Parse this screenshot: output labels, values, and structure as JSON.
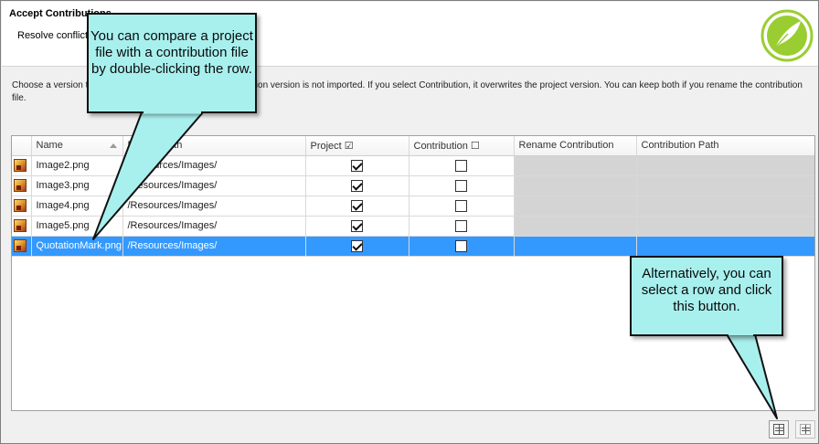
{
  "header": {
    "title": "Accept Contributions",
    "subtitle": "Resolve conflicts"
  },
  "instructions": "Choose a version to keep. If you select Project, the contribution version is not imported. If you select Contribution, it overwrites the project version. You can keep both if you rename the contribution file.",
  "table": {
    "columns": [
      "Name",
      "Project Path",
      "Project ☑",
      "Contribution ☐",
      "Rename Contribution",
      "Contribution Path"
    ],
    "rows": [
      {
        "name": "Image2.png",
        "path": "/Resources/Images/",
        "project": true,
        "contribution": false,
        "selected": false
      },
      {
        "name": "Image3.png",
        "path": "/Resources/Images/",
        "project": true,
        "contribution": false,
        "selected": false
      },
      {
        "name": "Image4.png",
        "path": "/Resources/Images/",
        "project": true,
        "contribution": false,
        "selected": false
      },
      {
        "name": "Image5.png",
        "path": "/Resources/Images/",
        "project": true,
        "contribution": false,
        "selected": false
      },
      {
        "name": "QuotationMark.png",
        "path": "/Resources/Images/",
        "project": true,
        "contribution": false,
        "selected": true
      }
    ]
  },
  "callouts": {
    "compare_row": "You can compare a project file with a contribution file by double-clicking the row.",
    "compare_button": "Alternatively, you can select a row and click this button."
  },
  "colors": {
    "callout_fill": "#a8f0ee",
    "selection": "#3399ff",
    "logo_green": "#9acd32"
  },
  "icons": {
    "logo": "feather-logo-icon",
    "file": "image-file-icon",
    "compare": "compare-files-icon"
  }
}
